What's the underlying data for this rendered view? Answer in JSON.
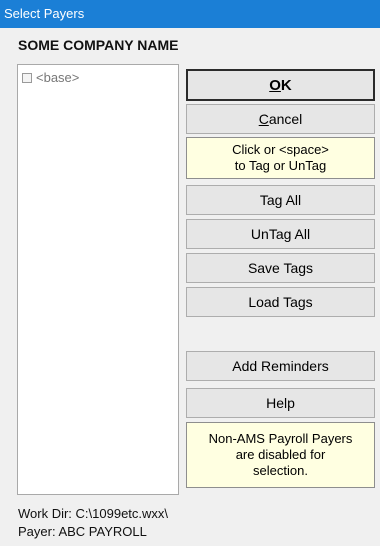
{
  "window": {
    "title": "Select Payers"
  },
  "company_name": "SOME COMPANY NAME",
  "payer_list": {
    "items": [
      {
        "label": "<base>",
        "checked": false
      }
    ]
  },
  "buttons": {
    "ok": "OK",
    "cancel": "Cancel",
    "tag_all": "Tag All",
    "untag_all": "UnTag All",
    "save_tags": "Save Tags",
    "load_tags": "Load Tags",
    "add_reminders": "Add Reminders",
    "help": "Help"
  },
  "notes": {
    "tag_hint_line1": "Click or <space>",
    "tag_hint_line2": "to Tag or UnTag",
    "disabled_line1": "Non-AMS Payroll Payers",
    "disabled_line2": "are disabled for",
    "disabled_line3": "selection."
  },
  "status": {
    "work_dir": "Work Dir: C:\\1099etc.wxx\\",
    "payer": "Payer: ABC PAYROLL"
  },
  "colors": {
    "titlebar": "#1b7fd6",
    "note_background": "#ffffe1",
    "button_face": "#e6e6e6"
  }
}
